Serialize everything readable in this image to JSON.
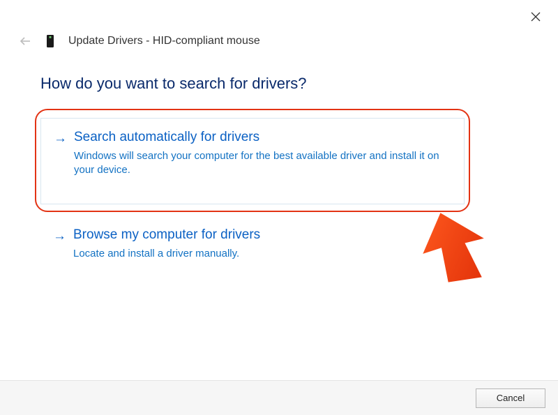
{
  "window": {
    "title": "Update Drivers - HID-compliant mouse"
  },
  "heading": "How do you want to search for drivers?",
  "options": {
    "auto": {
      "title": "Search automatically for drivers",
      "desc": "Windows will search your computer for the best available driver and install it on your device."
    },
    "browse": {
      "title": "Browse my computer for drivers",
      "desc": "Locate and install a driver manually."
    }
  },
  "footer": {
    "cancel": "Cancel"
  }
}
